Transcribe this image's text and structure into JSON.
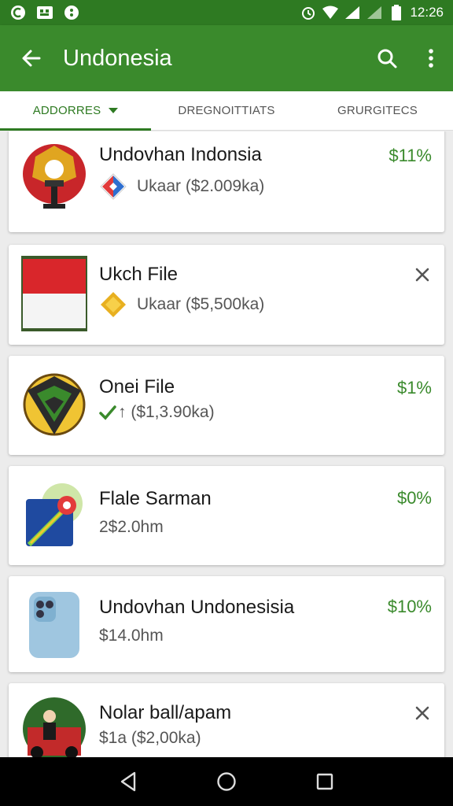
{
  "status_bar": {
    "time": "12:26"
  },
  "app_bar": {
    "title": "Undonesia"
  },
  "tabs": [
    {
      "label": "ADDORRES",
      "active": true
    },
    {
      "label": "DREGNOITTIATS",
      "active": false
    },
    {
      "label": "GRURGITECS",
      "active": false
    }
  ],
  "items": [
    {
      "title": "Undovhan Indonsia",
      "subtitle": "Ukaar (​$2.009ka)",
      "value": "$11%",
      "action": "value"
    },
    {
      "title": "Ukch File",
      "subtitle": "Ukaar (​$5,500ka)",
      "value": "",
      "action": "close"
    },
    {
      "title": "Onei File",
      "subtitle": "↑ ($1,3.90ka)",
      "value": "$1%",
      "action": "value"
    },
    {
      "title": "Flale Sarman",
      "subtitle": "2$2.0hm",
      "value": "$0%",
      "action": "value"
    },
    {
      "title": "Undovhan Undonesisia",
      "subtitle": "$14.0hm",
      "value": "$10%",
      "action": "value"
    },
    {
      "title": "Nolar ball/apam",
      "subtitle": "$1a ($2,00ka)",
      "value": "",
      "action": "close"
    }
  ],
  "colors": {
    "primary": "#3a8a2c",
    "status": "#2e7a22",
    "accent_value": "#3a8a2c"
  }
}
